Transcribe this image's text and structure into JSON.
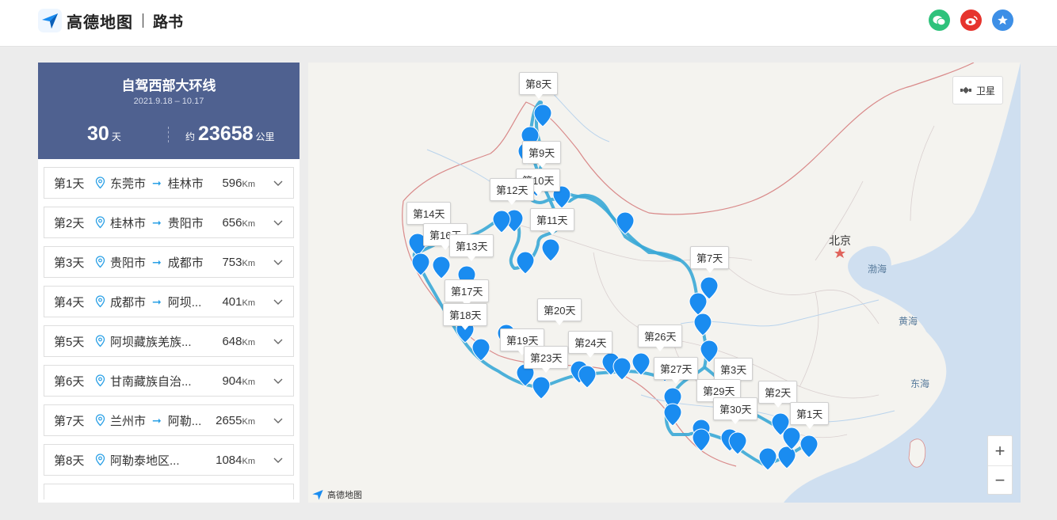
{
  "header": {
    "brand": "高德地图",
    "section": "路书",
    "share": [
      {
        "name": "wechat-share-icon",
        "glyph": "✉",
        "color": "#2fc27c"
      },
      {
        "name": "weibo-share-icon",
        "glyph": "◉",
        "color": "#e6342d"
      },
      {
        "name": "favorite-icon",
        "glyph": "★",
        "color": "#3d8fe6"
      }
    ]
  },
  "trip": {
    "title": "自驾西部大环线",
    "dates": "2021.9.18 – 10.17",
    "days_num": "30",
    "days_unit": "天",
    "distance_prefix": "约",
    "distance_num": "23658",
    "distance_unit": "公里"
  },
  "days": [
    {
      "label": "第1天",
      "from": "东莞市",
      "to": "桂林市",
      "long": "",
      "dist": "596",
      "unit": "Km"
    },
    {
      "label": "第2天",
      "from": "桂林市",
      "to": "贵阳市",
      "long": "",
      "dist": "656",
      "unit": "Km"
    },
    {
      "label": "第3天",
      "from": "贵阳市",
      "to": "成都市",
      "long": "",
      "dist": "753",
      "unit": "Km"
    },
    {
      "label": "第4天",
      "from": "成都市",
      "to": "阿坝...",
      "long": "",
      "dist": "401",
      "unit": "Km"
    },
    {
      "label": "第5天",
      "from": "",
      "to": "",
      "long": "阿坝藏族羌族...",
      "dist": "648",
      "unit": "Km"
    },
    {
      "label": "第6天",
      "from": "",
      "to": "",
      "long": "甘南藏族自治...",
      "dist": "904",
      "unit": "Km"
    },
    {
      "label": "第7天",
      "from": "兰州市",
      "to": "阿勒...",
      "long": "",
      "dist": "2655",
      "unit": "Km"
    },
    {
      "label": "第8天",
      "from": "",
      "to": "",
      "long": "阿勒泰地区...",
      "dist": "1084",
      "unit": "Km"
    }
  ],
  "map": {
    "satellite_label": "卫星",
    "zoom_in": "+",
    "zoom_out": "−",
    "brand": "高德地图",
    "labels": {
      "beijing": "北京",
      "bohai": "渤海",
      "huanghai": "黄海",
      "donghai": "东海"
    },
    "tips": [
      "第1天",
      "第2天",
      "第3天",
      "第7天",
      "第8天",
      "第9天",
      "第10天",
      "第11天",
      "第12天",
      "第13天",
      "第14天",
      "第16天",
      "第17天",
      "第18天",
      "第19天",
      "第20天",
      "第23天",
      "第24天",
      "第26天",
      "第27天",
      "第29天",
      "第30天"
    ],
    "colors": {
      "route": "#3aa8d6",
      "pin": "#1a8cf0",
      "water": "#cfdff0",
      "land": "#f4f3ef",
      "border": "#d98a8a"
    }
  }
}
